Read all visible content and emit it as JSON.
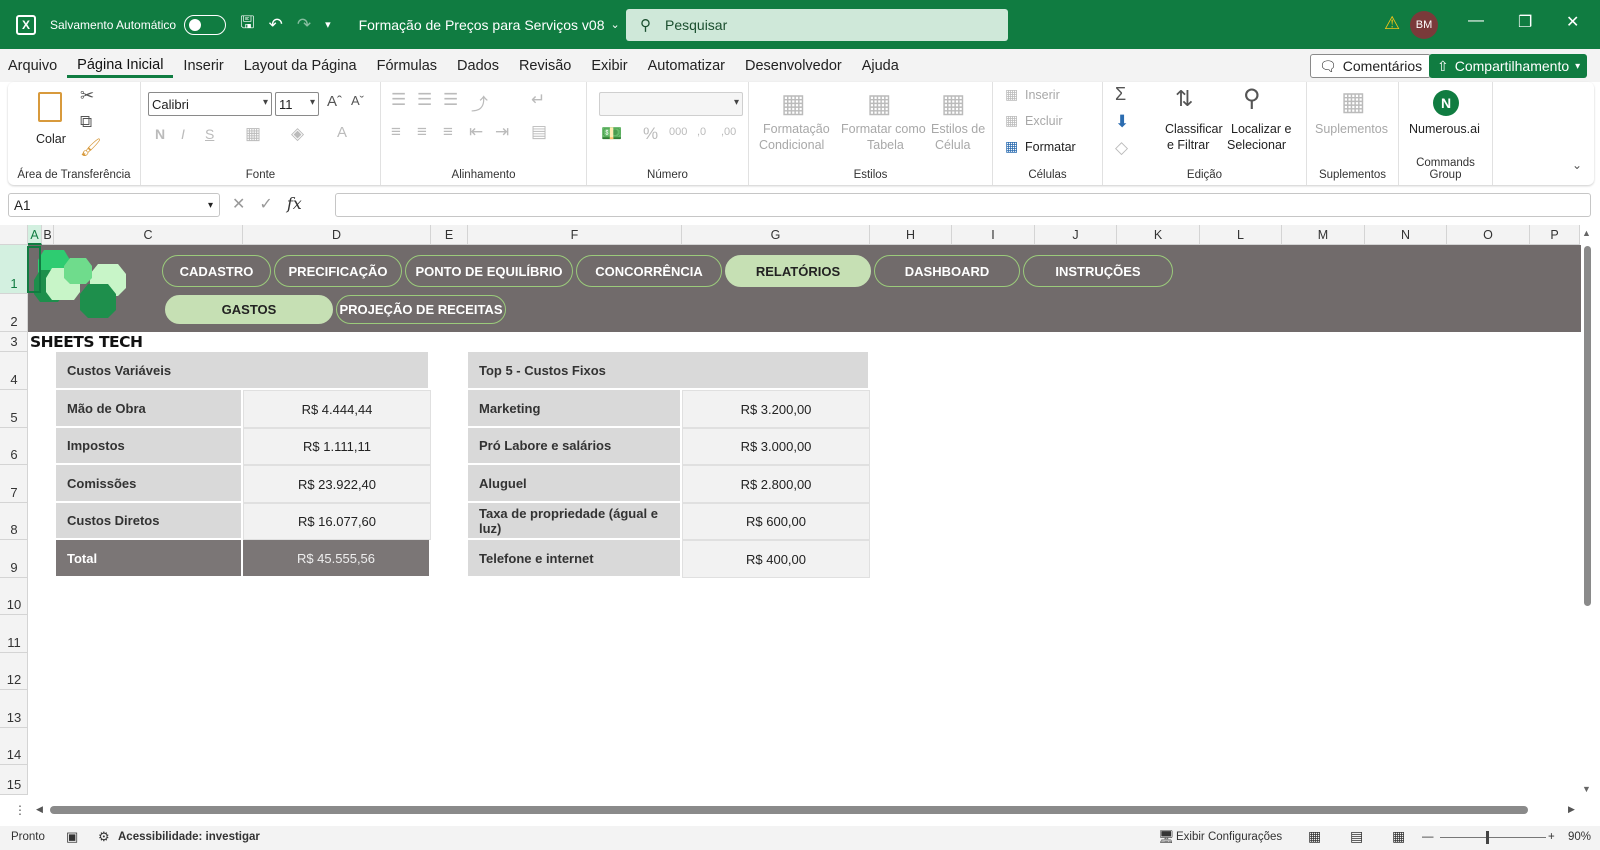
{
  "titlebar": {
    "autosave_label": "Salvamento Automático",
    "doc_title": "Formação de Preços para Serviços  v08",
    "search_placeholder": "Pesquisar",
    "avatar": "BM"
  },
  "menu": {
    "items": [
      "Arquivo",
      "Página Inicial",
      "Inserir",
      "Layout da Página",
      "Fórmulas",
      "Dados",
      "Revisão",
      "Exibir",
      "Automatizar",
      "Desenvolvedor",
      "Ajuda"
    ],
    "active": "Página Inicial",
    "comments": "Comentários",
    "share": "Compartilhamento"
  },
  "ribbon": {
    "clipboard": {
      "label": "Área de Transferência",
      "paste": "Colar"
    },
    "font": {
      "label": "Fonte",
      "family": "Calibri",
      "size": "11"
    },
    "alignment": {
      "label": "Alinhamento"
    },
    "number": {
      "label": "Número"
    },
    "styles": {
      "label": "Estilos",
      "cond_1": "Formatação",
      "cond_2": "Condicional",
      "table_1": "Formatar como",
      "table_2": "Tabela",
      "cell_1": "Estilos de",
      "cell_2": "Célula"
    },
    "cells": {
      "label": "Células",
      "insert": "Inserir",
      "delete": "Excluir",
      "format": "Formatar"
    },
    "editing": {
      "label": "Edição",
      "sort_1": "Classificar",
      "sort_2": "e Filtrar",
      "find_1": "Localizar e",
      "find_2": "Selecionar"
    },
    "addins": {
      "label": "Suplementos",
      "btn": "Suplementos"
    },
    "commands": {
      "label": "Commands Group",
      "btn": "Numerous.ai"
    }
  },
  "formula_bar": {
    "name_box": "A1",
    "fx": "fx",
    "formula": ""
  },
  "columns": [
    "A",
    "B",
    "C",
    "D",
    "E",
    "F",
    "G",
    "H",
    "I",
    "J",
    "K",
    "L",
    "M",
    "N",
    "O",
    "P"
  ],
  "rows": [
    "1",
    "2",
    "3",
    "4",
    "5",
    "6",
    "7",
    "8",
    "9",
    "10",
    "11",
    "12",
    "13",
    "14",
    "15"
  ],
  "nav": {
    "top": [
      "CADASTRO",
      "PRECIFICAÇÃO",
      "PONTO DE EQUILÍBRIO",
      "CONCORRÊNCIA",
      "RELATÓRIOS",
      "DASHBOARD",
      "INSTRUÇÕES"
    ],
    "sub": [
      "GASTOS",
      "PROJEÇÃO DE RECEITAS"
    ],
    "active_top": "RELATÓRIOS",
    "active_sub": "GASTOS"
  },
  "logo_text": "SHEETS TECH",
  "variable_costs": {
    "title": "Custos Variáveis",
    "rows": [
      {
        "label": "Mão de Obra",
        "value": "R$ 4.444,44"
      },
      {
        "label": "Impostos",
        "value": "R$ 1.111,11"
      },
      {
        "label": "Comissões",
        "value": "R$ 23.922,40"
      },
      {
        "label": "Custos Diretos",
        "value": "R$ 16.077,60"
      }
    ],
    "total_label": "Total",
    "total_value": "R$ 45.555,56"
  },
  "fixed_costs": {
    "title": "Top 5 - Custos Fixos",
    "rows": [
      {
        "label": "Marketing",
        "value": "R$ 3.200,00"
      },
      {
        "label": "Pró Labore e salários",
        "value": "R$ 3.000,00"
      },
      {
        "label": "Aluguel",
        "value": "R$ 2.800,00"
      },
      {
        "label": "Taxa de propriedade (águal e luz)",
        "value": "R$ 600,00"
      },
      {
        "label": "Telefone e internet",
        "value": "R$ 400,00"
      }
    ]
  },
  "status": {
    "ready": "Pronto",
    "accessibility": "Acessibilidade: investigar",
    "display_settings": "Exibir Configurações",
    "zoom": "90%"
  },
  "colors": {
    "excel_green": "#107c41",
    "banner": "#716b6b",
    "active_pill": "#c6e0b4",
    "cell_label": "#d9d9d9"
  }
}
